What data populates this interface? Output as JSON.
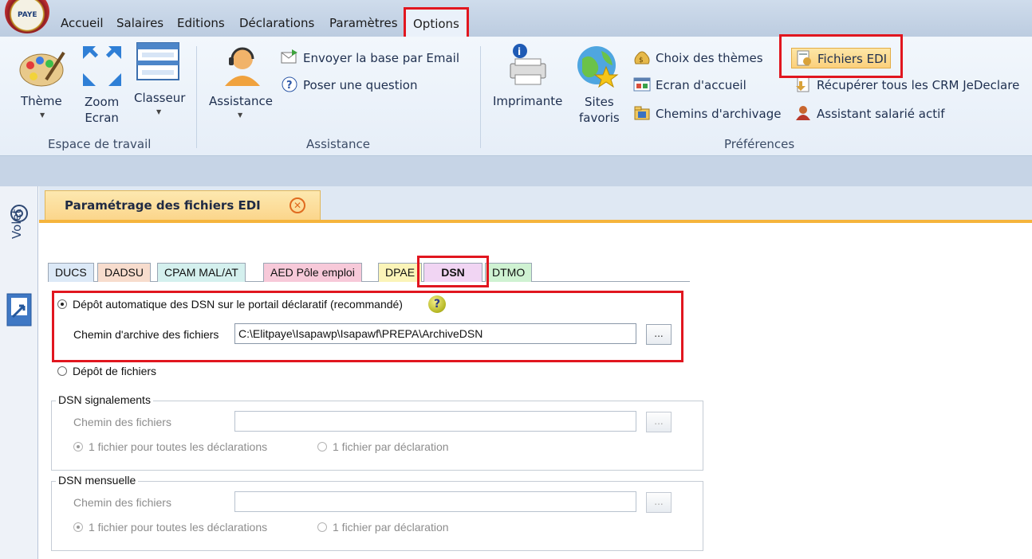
{
  "app": {
    "logo_text": "PAYE"
  },
  "menubar": {
    "items": [
      "Accueil",
      "Salaires",
      "Editions",
      "Déclarations",
      "Paramètres",
      "Options"
    ]
  },
  "ribbon": {
    "espace_travail": {
      "theme": "Thème",
      "zoom_line1": "Zoom",
      "zoom_line2": "Ecran",
      "classeur": "Classeur",
      "group_label": "Espace de travail"
    },
    "assistance": {
      "assistance": "Assistance",
      "envoyer": "Envoyer la base par Email",
      "poser": "Poser une question",
      "group_label": "Assistance"
    },
    "preferences": {
      "imprimante": "Imprimante",
      "sites_line1": "Sites",
      "sites_line2": "favoris",
      "choix_themes": "Choix des thèmes",
      "ecran_accueil": "Ecran d'accueil",
      "chemins_archivage": "Chemins d'archivage",
      "fichiers_edi": "Fichiers EDI",
      "recuperer_crm": "Récupérer tous les CRM JeDeclare",
      "assistant_salarie": "Assistant salarié actif",
      "group_label": "Préférences"
    }
  },
  "volet": {
    "label": "Volet"
  },
  "document_tab": {
    "title": "Paramétrage des fichiers EDI",
    "close_glyph": "✕"
  },
  "subtabs": [
    {
      "label": "DUCS",
      "color": "#dce9f7"
    },
    {
      "label": "DADSU",
      "color": "#f7dccd"
    },
    {
      "label": "CPAM MAL/AT",
      "color": "#d4f0ee"
    },
    {
      "label": "AED Pôle emploi",
      "color": "#f7c9d9"
    },
    {
      "label": "DPAE",
      "color": "#fbf4b8"
    },
    {
      "label": "DSN",
      "color": "#f1d5f3"
    },
    {
      "label": "DTMO",
      "color": "#cff2d2"
    }
  ],
  "form": {
    "depot_auto_label": "Dépôt automatique des DSN sur le portail déclaratif (recommandé)",
    "help_glyph": "?",
    "chemin_archive_label": "Chemin d'archive des fichiers",
    "chemin_archive_value": "C:\\Elitpaye\\Isapawp\\Isapawf\\PREPA\\ArchiveDSN",
    "browse_label": "...",
    "depot_fichiers_label": "Dépôt de fichiers",
    "signalements": {
      "title": "DSN signalements",
      "chemin_label": "Chemin des fichiers",
      "chemin_value": "",
      "browse_label": "...",
      "option_all": "1 fichier pour toutes les déclarations",
      "option_each": "1 fichier par déclaration"
    },
    "mensuelle": {
      "title": "DSN mensuelle",
      "chemin_label": "Chemin des fichiers",
      "chemin_value": "",
      "browse_label": "...",
      "option_all": "1 fichier pour toutes les déclarations",
      "option_each": "1 fichier par déclaration"
    }
  },
  "colors": {
    "highlight_red": "#e1161f",
    "doc_tab": "#fbd58a",
    "ribbon_bg": "#eaf1f9"
  }
}
